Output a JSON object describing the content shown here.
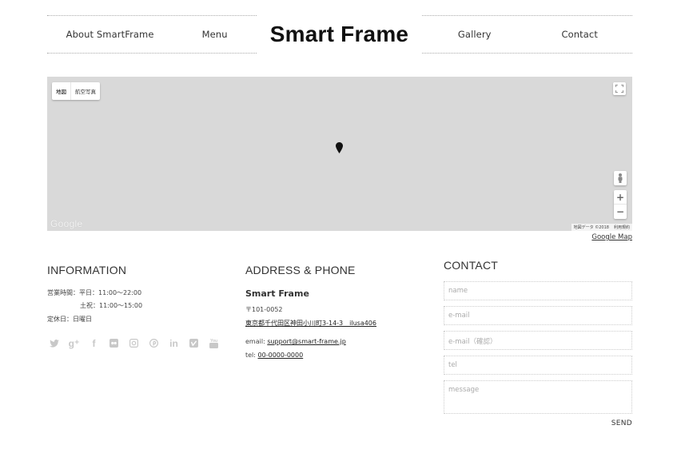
{
  "header": {
    "nav_left": [
      "About SmartFrame",
      "Menu"
    ],
    "logo": "Smart Frame",
    "nav_right": [
      "Gallery",
      "Contact"
    ]
  },
  "map": {
    "type_buttons": [
      "地図",
      "航空写真"
    ],
    "logo": "Google",
    "footer": [
      "地図データ ©2018",
      "利用規約"
    ],
    "zoom_in": "+",
    "zoom_out": "−",
    "link": "Google Map"
  },
  "information": {
    "title": "INFORMATION",
    "hours_label": "営業時間：平日：11:00〜22:00",
    "hours_holiday": "土祝：11:00〜15:00",
    "closed": "定休日：日曜日",
    "social_icons": [
      "twitter-icon",
      "google-plus-icon",
      "facebook-icon",
      "flickr-icon",
      "instagram-icon",
      "pinterest-icon",
      "linkedin-icon",
      "vimeo-icon",
      "youtube-icon"
    ]
  },
  "address": {
    "title": "ADDRESS & PHONE",
    "name": "Smart Frame",
    "postal": "〒101-0052",
    "street": "東京都千代田区神田小川町3-14-3　ilusa406",
    "email_label": "email:",
    "email": "support@smart-frame.jp",
    "tel_label": "tel:",
    "tel": "00-0000-0000"
  },
  "contact": {
    "title": "CONTACT",
    "placeholders": {
      "name": "name",
      "email": "e-mail",
      "email_confirm": "e-mail（確認）",
      "tel": "tel",
      "message": "message"
    },
    "send": "SEND"
  }
}
